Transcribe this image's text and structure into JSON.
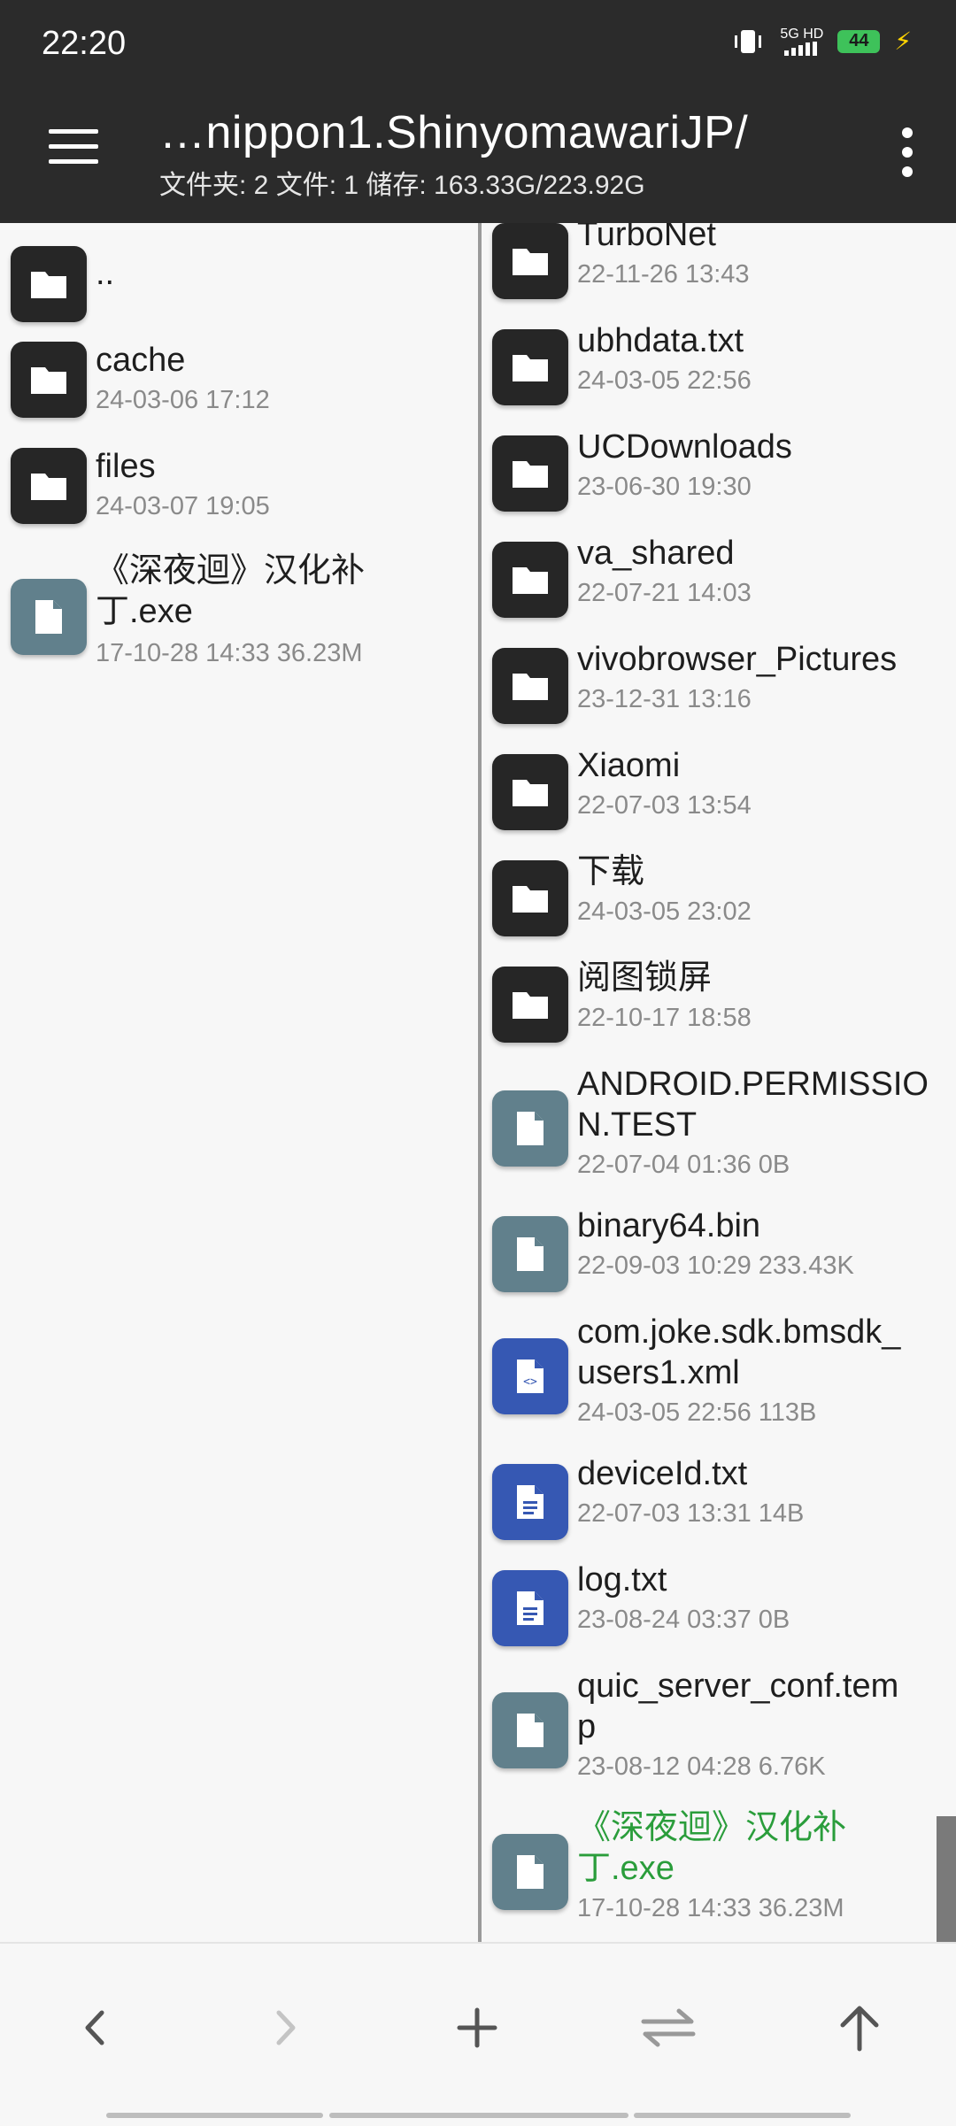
{
  "status": {
    "time": "22:20",
    "network": "5G HD",
    "battery": "44"
  },
  "header": {
    "path": "…nippon1.ShinyomawariJP/",
    "summary": "文件夹: 2  文件: 1  储存: 163.33G/223.92G"
  },
  "left_pane": {
    "items": [
      {
        "name": "..",
        "meta": "",
        "type": "folder"
      },
      {
        "name": "cache",
        "meta": "24-03-06 17:12",
        "type": "folder"
      },
      {
        "name": "files",
        "meta": "24-03-07 19:05",
        "type": "folder"
      },
      {
        "name": "《深夜迴》汉化补\n丁.exe",
        "meta": "17-10-28 14:33  36.23M",
        "type": "file"
      }
    ]
  },
  "right_pane": {
    "items": [
      {
        "name": "TurboNet",
        "meta": "22-11-26 13:43",
        "type": "folder"
      },
      {
        "name": "ubhdata.txt",
        "meta": "24-03-05 22:56",
        "type": "folder"
      },
      {
        "name": "UCDownloads",
        "meta": "23-06-30 19:30",
        "type": "folder"
      },
      {
        "name": "va_shared",
        "meta": "22-07-21 14:03",
        "type": "folder"
      },
      {
        "name": "vivobrowser_Pictures",
        "meta": "23-12-31 13:16",
        "type": "folder"
      },
      {
        "name": "Xiaomi",
        "meta": "22-07-03 13:54",
        "type": "folder"
      },
      {
        "name": "下载",
        "meta": "24-03-05 23:02",
        "type": "folder"
      },
      {
        "name": "阅图锁屏",
        "meta": "22-10-17 18:58",
        "type": "folder"
      },
      {
        "name": "ANDROID.PERMISSIO\nN.TEST",
        "meta": "22-07-04 01:36  0B",
        "type": "file"
      },
      {
        "name": "binary64.bin",
        "meta": "22-09-03 10:29  233.43K",
        "type": "file"
      },
      {
        "name": "com.joke.sdk.bmsdk_\nusers1.xml",
        "meta": "24-03-05 22:56  113B",
        "type": "xml"
      },
      {
        "name": "deviceId.txt",
        "meta": "22-07-03 13:31  14B",
        "type": "text"
      },
      {
        "name": "log.txt",
        "meta": "23-08-24 03:37  0B",
        "type": "text"
      },
      {
        "name": "quic_server_conf.tem\np",
        "meta": "23-08-12 04:28  6.76K",
        "type": "file"
      },
      {
        "name": "《深夜迴》汉化补\n丁.exe",
        "meta": "17-10-28 14:33  36.23M",
        "type": "file",
        "highlight": true
      }
    ]
  },
  "bottom_bar": {
    "buttons": [
      "back",
      "forward",
      "add",
      "swap",
      "up"
    ]
  }
}
